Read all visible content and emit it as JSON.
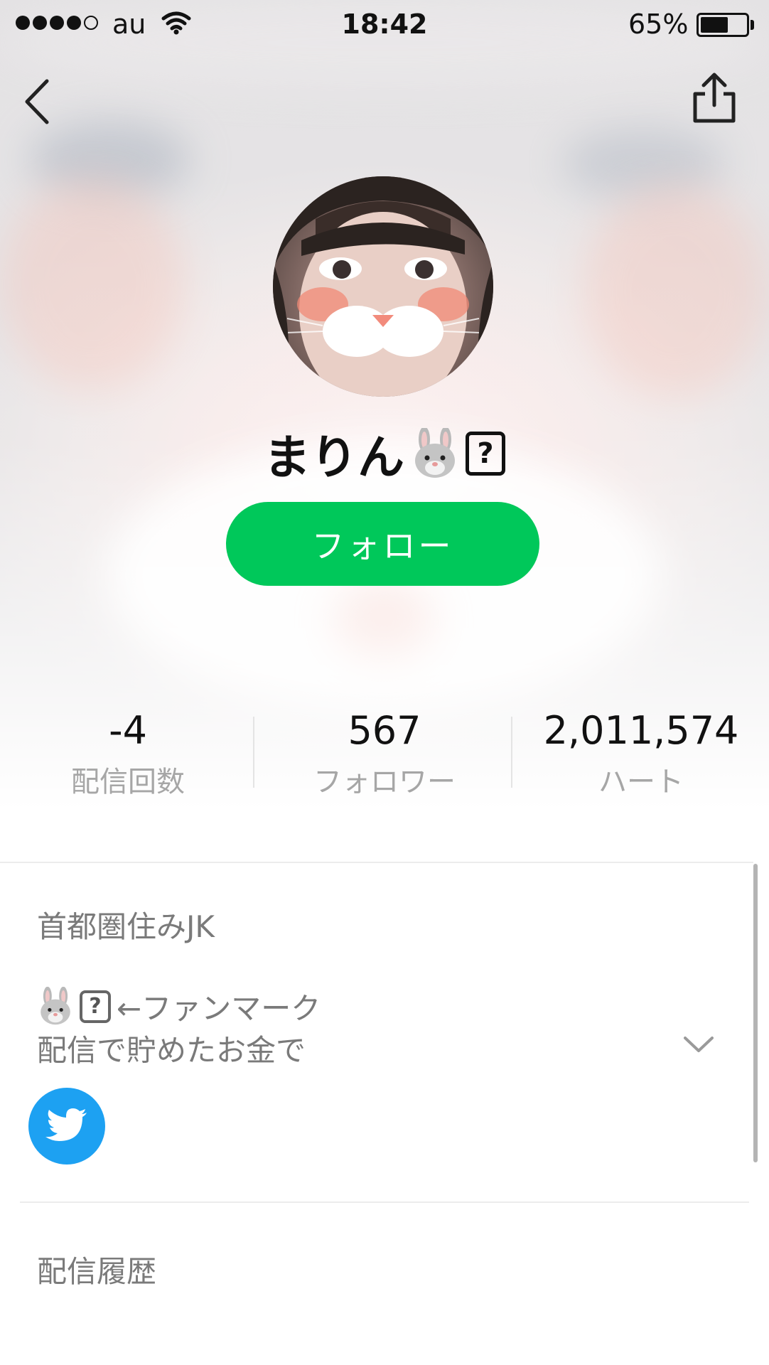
{
  "status_bar": {
    "carrier": "au",
    "time": "18:42",
    "battery_percent_text": "65%",
    "battery_level": 0.65,
    "signal_bars_filled": 4,
    "signal_bars_total": 5
  },
  "nav": {
    "back_icon": "chevron-left-icon",
    "share_icon": "share-icon"
  },
  "profile": {
    "name": "まりん",
    "name_emoji": "rabbit-face-icon",
    "name_unknown_glyph": "?",
    "follow_label": "フォロー",
    "accent_color": "#00c85a"
  },
  "stats": [
    {
      "value": "-4",
      "label": "配信回数"
    },
    {
      "value": "567",
      "label": "フォロワー"
    },
    {
      "value": "2,011,574",
      "label": "ハート"
    }
  ],
  "bio": {
    "line1": "首都圏住みJK",
    "line2_emoji": "rabbit-face-icon",
    "line2_unknown_glyph": "?",
    "line2_text": "←ファンマーク",
    "line3": "配信で貯めたお金で",
    "expand_icon": "chevron-down-icon",
    "twitter_icon": "twitter-icon",
    "twitter_color": "#1da1f2"
  },
  "history": {
    "title": "配信履歴"
  }
}
